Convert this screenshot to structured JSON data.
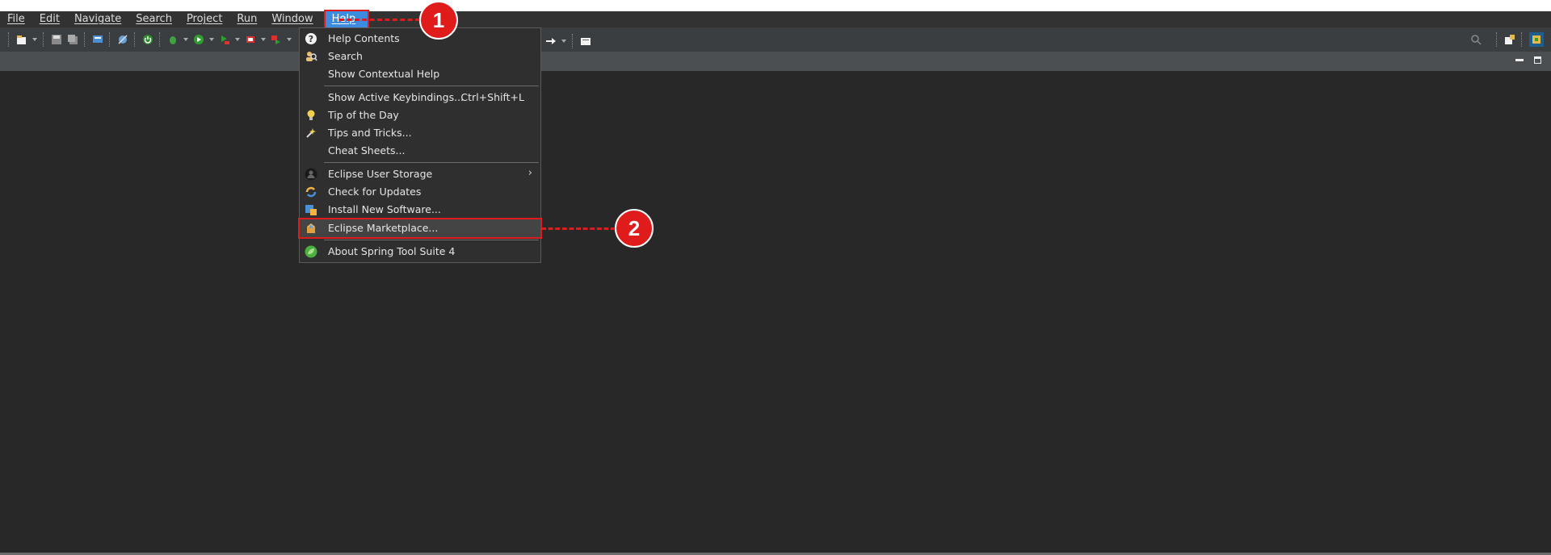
{
  "menubar": {
    "items": [
      "File",
      "Edit",
      "Navigate",
      "Search",
      "Project",
      "Run",
      "Window",
      "Help"
    ]
  },
  "help_menu": {
    "items": [
      {
        "label": "Help Contents",
        "icon": "help-icon"
      },
      {
        "label": "Search",
        "icon": "search-people-icon"
      },
      {
        "label": "Show Contextual Help",
        "icon": ""
      },
      {
        "label": "Show Active Keybindings...",
        "shortcut": "Ctrl+Shift+L",
        "icon": ""
      },
      {
        "label": "Tip of the Day",
        "icon": "lightbulb-icon"
      },
      {
        "label": "Tips and Tricks...",
        "icon": "tips-icon"
      },
      {
        "label": "Cheat Sheets...",
        "icon": ""
      },
      {
        "label": "Eclipse User Storage",
        "icon": "user-icon",
        "submenu_glyph": "›"
      },
      {
        "label": "Check for Updates",
        "icon": "update-icon"
      },
      {
        "label": "Install New Software...",
        "icon": "install-icon"
      },
      {
        "label": "Eclipse Marketplace...",
        "icon": "marketplace-icon"
      },
      {
        "label": "About Spring Tool Suite 4",
        "icon": "spring-leaf-icon"
      }
    ]
  },
  "callouts": {
    "one": "1",
    "two": "2"
  },
  "colors": {
    "accent": "#3b8cde",
    "callout": "#e01b1b",
    "background": "#282828"
  }
}
